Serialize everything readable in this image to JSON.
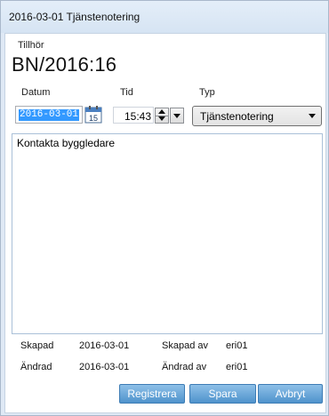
{
  "window": {
    "title": "2016-03-01 Tjänstenotering"
  },
  "header": {
    "belongs_label": "Tillhör",
    "case_id": "BN/2016:16"
  },
  "fields": {
    "date_label": "Datum",
    "date_value": "2016-03-01",
    "calendar_icon_text": "15",
    "time_label": "Tid",
    "time_value": "15:43",
    "type_label": "Typ",
    "type_value": "Tjänstenotering"
  },
  "notes": {
    "text": "Kontakta byggledare"
  },
  "meta": {
    "created_label": "Skapad",
    "created_date": "2016-03-01",
    "created_by_label": "Skapad av",
    "created_by": "eri01",
    "changed_label": "Ändrad",
    "changed_date": "2016-03-01",
    "changed_by_label": "Ändrad av",
    "changed_by": "eri01"
  },
  "buttons": {
    "register": "Registrera",
    "save": "Spara",
    "cancel": "Avbryt"
  },
  "colors": {
    "accent": "#4f93cc",
    "selection": "#3399ff",
    "frame": "#dfe9f5"
  },
  "icons": [
    "calendar-icon",
    "spin-up-icon",
    "spin-down-icon",
    "chevron-down-icon"
  ]
}
